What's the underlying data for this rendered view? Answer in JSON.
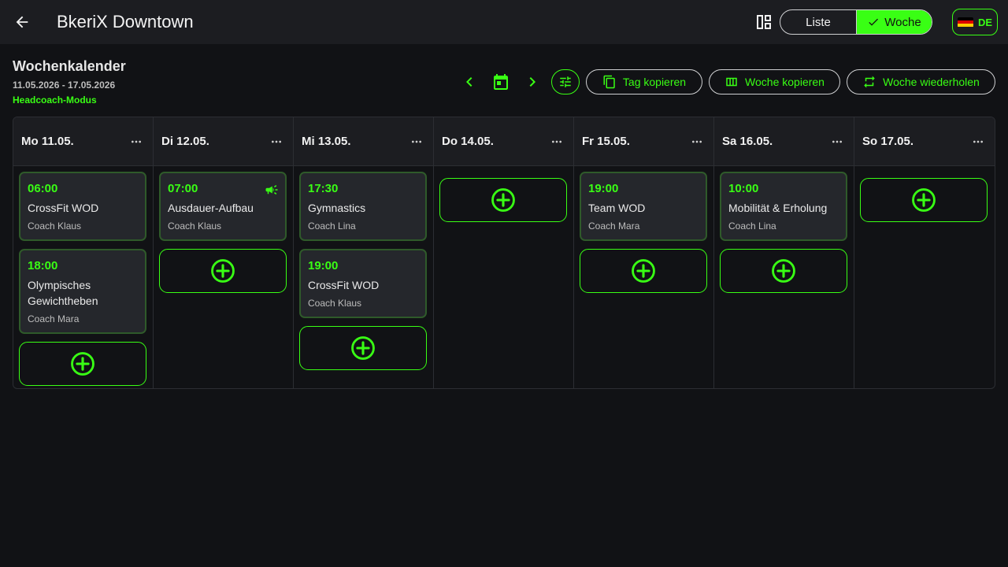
{
  "appbar": {
    "title": "BkeriX Downtown",
    "view_toggle": {
      "list_label": "Liste",
      "week_label": "Woche",
      "selected": "Woche"
    },
    "language": "DE"
  },
  "header": {
    "title": "Wochenkalender",
    "date_range": "11.05.2026 - 17.05.2026",
    "mode": "Headcoach-Modus"
  },
  "toolbar": {
    "copy_day": "Tag kopieren",
    "copy_week": "Woche kopieren",
    "repeat_week": "Woche wiederholen"
  },
  "colors": {
    "accent": "#39ff14",
    "background": "#111215",
    "surface": "#1c1d21",
    "card": "#25272c"
  },
  "days": [
    {
      "label": "Mo 11.05.",
      "sessions": [
        {
          "time": "06:00",
          "name": "CrossFit WOD",
          "coach": "Coach Klaus"
        },
        {
          "time": "18:00",
          "name": "Olympisches Gewichtheben",
          "coach": "Coach Mara"
        }
      ]
    },
    {
      "label": "Di 12.05.",
      "sessions": [
        {
          "time": "07:00",
          "name": "Ausdauer-Aufbau",
          "coach": "Coach Klaus",
          "announcement": true
        }
      ]
    },
    {
      "label": "Mi 13.05.",
      "sessions": [
        {
          "time": "17:30",
          "name": "Gymnastics",
          "coach": "Coach Lina"
        },
        {
          "time": "19:00",
          "name": "CrossFit WOD",
          "coach": "Coach Klaus"
        }
      ]
    },
    {
      "label": "Do 14.05.",
      "sessions": []
    },
    {
      "label": "Fr 15.05.",
      "sessions": [
        {
          "time": "19:00",
          "name": "Team WOD",
          "coach": "Coach Mara"
        }
      ]
    },
    {
      "label": "Sa 16.05.",
      "sessions": [
        {
          "time": "10:00",
          "name": "Mobilität & Erholung",
          "coach": "Coach Lina"
        }
      ]
    },
    {
      "label": "So 17.05.",
      "sessions": []
    }
  ]
}
